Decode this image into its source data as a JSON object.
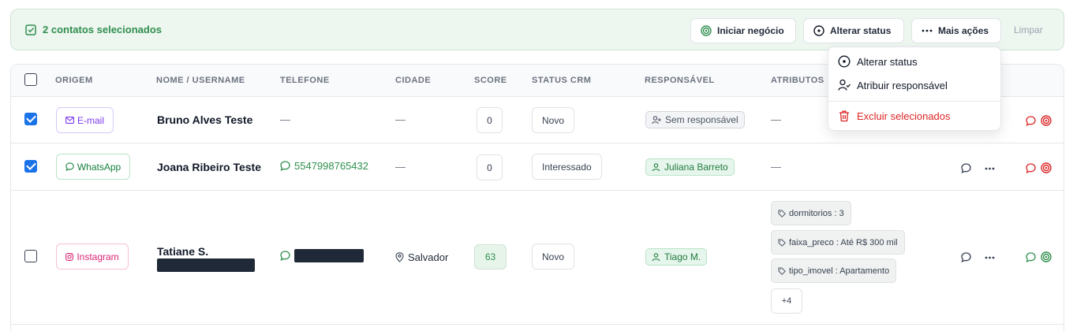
{
  "selection_bar": {
    "count_text": "2 contatos selecionados",
    "buttons": {
      "iniciar_negocio": "Iniciar negócio",
      "alterar_status": "Alterar status",
      "mais_acoes": "Mais ações",
      "limpar": "Limpar"
    }
  },
  "table": {
    "headers": [
      "ORIGEM",
      "NOME / USERNAME",
      "TELEFONE",
      "CIDADE",
      "SCORE",
      "STATUS CRM",
      "RESPONSÁVEL",
      "ATRIBUTOS"
    ],
    "rows": [
      {
        "checked": true,
        "origin": "E-mail",
        "name": "Bruno Alves Teste",
        "phone": "—",
        "city": "—",
        "score": "0",
        "status": "Novo",
        "responsible": "Sem responsável",
        "attributes_empty": "—"
      },
      {
        "checked": true,
        "origin": "WhatsApp",
        "name": "Joana Ribeiro Teste",
        "phone": "5547998765432",
        "city": "—",
        "score": "0",
        "status": "Interessado",
        "responsible": "Juliana Barreto",
        "attributes_empty": "—"
      },
      {
        "checked": false,
        "origin": "Instagram",
        "name": "Tatiane S.",
        "city": "Salvador",
        "score": "63",
        "status": "Novo",
        "responsible": "Tiago M.",
        "attributes": [
          "dormitorios : 3",
          "faixa_preco : Até R$ 300 mil",
          "tipo_imovel : Apartamento"
        ],
        "more_attributes": "+4"
      }
    ]
  },
  "dropdown": {
    "items": [
      "Alterar status",
      "Atribuir responsável"
    ],
    "danger_item": "Excluir selecionados"
  },
  "colors": {
    "accent_green": "#2f8f4e",
    "danger_red": "#dc2626",
    "checkbox_blue": "#1a73e8"
  }
}
